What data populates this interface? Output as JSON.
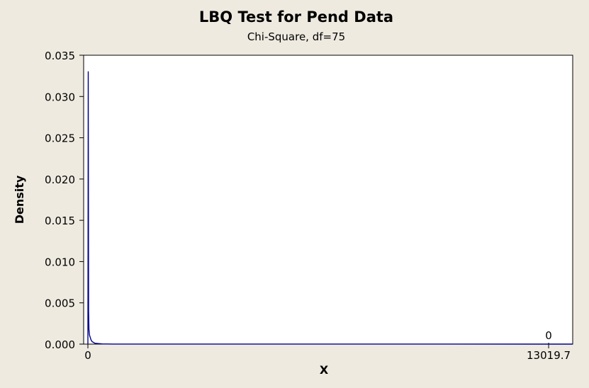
{
  "chart_data": {
    "type": "line",
    "title": "LBQ Test for Pend Data",
    "subtitle": "Chi-Square, df=75",
    "xlabel": "X",
    "ylabel": "Density",
    "xlim": [
      -120,
      13700
    ],
    "ylim": [
      0,
      0.035
    ],
    "y_ticks": [
      {
        "value": 0.0,
        "label": "0.000"
      },
      {
        "value": 0.005,
        "label": "0.005"
      },
      {
        "value": 0.01,
        "label": "0.010"
      },
      {
        "value": 0.015,
        "label": "0.015"
      },
      {
        "value": 0.02,
        "label": "0.020"
      },
      {
        "value": 0.025,
        "label": "0.025"
      },
      {
        "value": 0.03,
        "label": "0.030"
      },
      {
        "value": 0.035,
        "label": "0.035"
      }
    ],
    "x_ticks": [
      {
        "value": 0,
        "label": "0"
      },
      {
        "value": 13019.7,
        "label": "13019.7"
      }
    ],
    "annotations": [
      {
        "x": 13019.7,
        "y": 0,
        "text": "0"
      }
    ],
    "grid": false,
    "series": [
      {
        "color": "#00008B",
        "x": [
          0,
          0,
          5,
          10,
          20,
          30,
          45,
          60,
          75,
          90,
          120,
          200,
          400,
          700,
          13700
        ],
        "y": [
          0,
          0,
          0.012,
          0.033,
          0.004,
          0.0018,
          0.0011,
          0.0009,
          0.0007,
          0.0005,
          0.0003,
          0.0001,
          3e-05,
          5e-06,
          0
        ]
      }
    ],
    "colors": {
      "background": "#EEEAE0",
      "plot_area": "#FFFFFF",
      "line": "#00008B"
    }
  }
}
